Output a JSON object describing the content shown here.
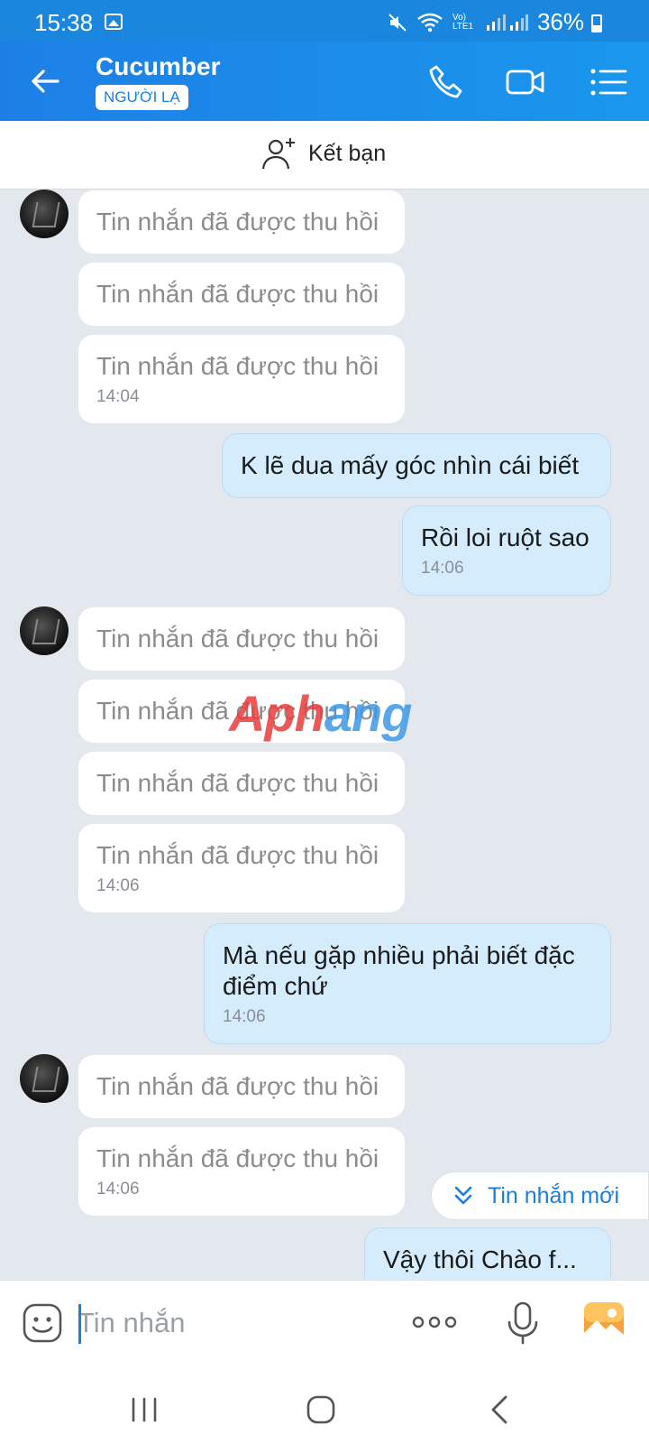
{
  "status": {
    "time": "15:38",
    "volte": "Vo) LTE1",
    "battery": "36%"
  },
  "header": {
    "name": "Cucumber",
    "badge": "NGƯỜI LẠ"
  },
  "friend_bar": {
    "label": "Kết bạn"
  },
  "messages": [
    {
      "text": "Tin nhắn đã được thu hồi",
      "time": ""
    },
    {
      "text": "Tin nhắn đã được thu hồi",
      "time": ""
    },
    {
      "text": "Tin nhắn đã được thu hồi",
      "time": "14:04"
    },
    {
      "text": "K lẽ dua mấy góc nhìn cái biết",
      "time": ""
    },
    {
      "text": "Rồi loi ruột sao",
      "time": "14:06"
    },
    {
      "text": "Tin nhắn đã được thu hồi",
      "time": ""
    },
    {
      "text": "Tin nhắn đã được thu hồi",
      "time": ""
    },
    {
      "text": "Tin nhắn đã được thu hồi",
      "time": ""
    },
    {
      "text": "Tin nhắn đã được thu hồi",
      "time": "14:06"
    },
    {
      "text": "Mà nếu gặp nhiều phải biết đặc điểm chứ",
      "time": "14:06"
    },
    {
      "text": "Tin nhắn đã được thu hồi",
      "time": ""
    },
    {
      "text": "Tin nhắn đã được thu hồi",
      "time": "14:06"
    },
    {
      "text": "Vậy thôi Chào f...",
      "time": ""
    }
  ],
  "new_messages_label": "Tin nhắn mới",
  "watermark": {
    "part1": "Aph",
    "part2": "ang"
  },
  "composer": {
    "placeholder": "Tin nhắn"
  },
  "colors": {
    "header": "#1a86de",
    "outgoing_bubble": "#d5ecfd",
    "accent": "#1a80e0"
  },
  "icons": [
    "back-icon",
    "phone-icon",
    "video-call-icon",
    "menu-icon",
    "add-friend-icon",
    "chevron-double-down-icon",
    "emoji-icon",
    "more-icon",
    "mic-icon",
    "photo-icon",
    "recent-apps-icon",
    "home-icon",
    "back-nav-icon"
  ]
}
